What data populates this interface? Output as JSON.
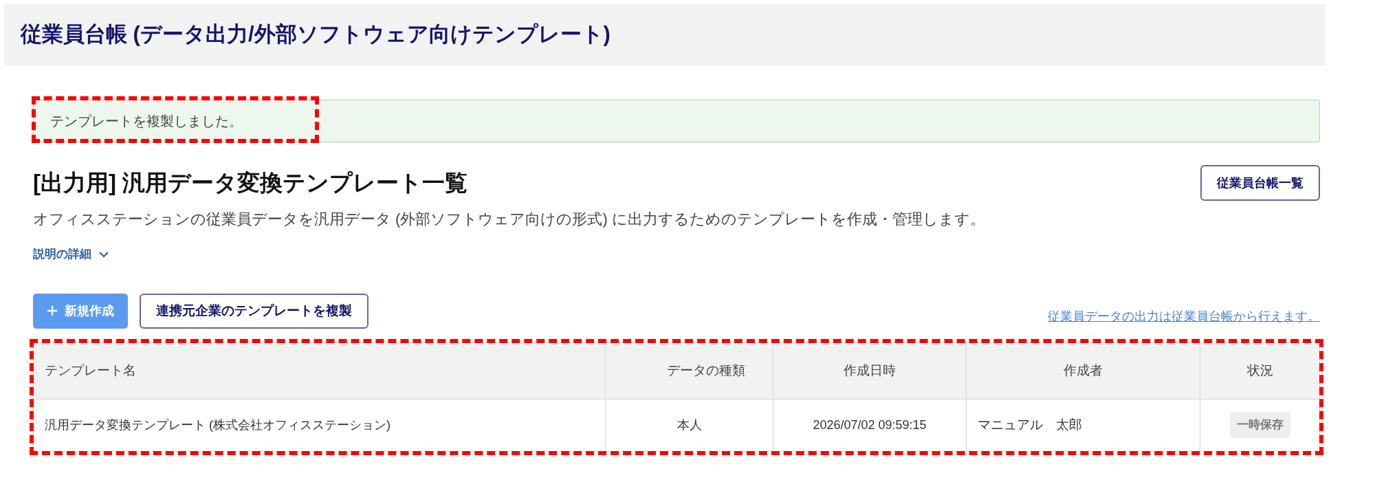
{
  "page_title": "従業員台帳 (データ出力/外部ソフトウェア向けテンプレート)",
  "alert": {
    "message": "テンプレートを複製しました。",
    "highlighted": true
  },
  "heading": "[出力用] 汎用データ変換テンプレート一覧",
  "header_button": "従業員台帳一覧",
  "description": "オフィスステーションの従業員データを汎用データ (外部ソフトウェア向けの形式) に出力するためのテンプレートを作成・管理します。",
  "details_toggle": {
    "label": "説明の詳細",
    "expanded": false
  },
  "actions": [
    {
      "kind": "primary",
      "label": "新規作成"
    },
    {
      "kind": "outline",
      "label": "連携元企業のテンプレートを複製"
    }
  ],
  "note_link": "従業員データの出力は従業員台帳から行えます。",
  "table": {
    "highlighted": true,
    "columns": [
      "テンプレート名",
      "データの種類",
      "作成日時",
      "作成者",
      "状況"
    ],
    "rows": [
      {
        "name": "汎用データ変換テンプレート (株式会社オフィスステーション)",
        "data_type": "本人",
        "created_at": "2026/07/02 09:59:15",
        "author": "マニュアル　太郎",
        "status": "一時保存"
      }
    ]
  }
}
